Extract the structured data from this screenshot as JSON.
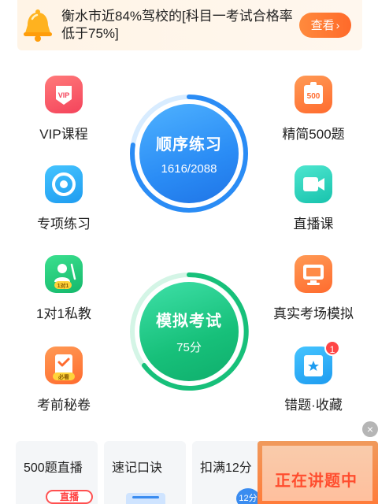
{
  "banner": {
    "text": "衡水市近84%驾校的[科目一考试合格率低于75%]",
    "button_label": "查看",
    "button_arrow": "›"
  },
  "features": {
    "vip": {
      "label": "VIP课程",
      "icon_text": "VIP"
    },
    "jingjian": {
      "label": "精简500题",
      "icon_text": "500"
    },
    "zhuanxiang": {
      "label": "专项练习"
    },
    "zhibo": {
      "label": "直播课"
    },
    "siJiao": {
      "label": "1对1私教",
      "icon_text": "1对1"
    },
    "zhenshi": {
      "label": "真实考场模拟"
    },
    "miJuan": {
      "label": "考前秘卷",
      "icon_text": "必看"
    },
    "cuoti": {
      "label": "错题·收藏",
      "badge": "1"
    }
  },
  "shunxu": {
    "title": "顺序练习",
    "progress_text": "1616/2088",
    "progress": 0.774
  },
  "moni": {
    "title": "模拟考试",
    "score_text": "75分"
  },
  "cards": [
    {
      "label": "500题直播",
      "tag": "直播"
    },
    {
      "label": "速记口诀"
    },
    {
      "label": "扣满12分",
      "tag": "12分"
    }
  ],
  "live": {
    "label": "正在讲题中"
  },
  "close_symbol": "×",
  "colors": {
    "accent_blue": "#2a8cf5",
    "accent_green": "#17c07a",
    "accent_orange": "#ff6a2a"
  }
}
